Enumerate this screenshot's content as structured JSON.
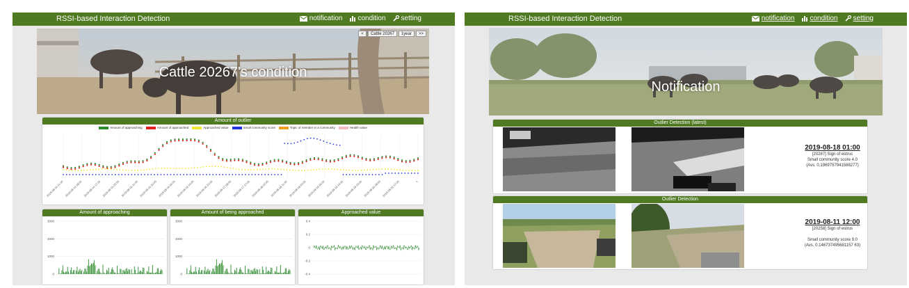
{
  "app": {
    "title": "RSSI-based Interaction Detection",
    "nav": {
      "notification": "notification",
      "condition": "condition",
      "setting": "setting"
    }
  },
  "left": {
    "hero_title": "Cattle 20267's condition",
    "selector": {
      "prev": "<<",
      "prev2": "<",
      "cattle": "Cattle 20267",
      "period": "1year",
      "next": ">>"
    },
    "main_chart": {
      "title": "Amount of outlier",
      "legend": [
        {
          "label": "Amount of approaching",
          "color": "#2e8b2e"
        },
        {
          "label": "Amount of approached",
          "color": "#e02020"
        },
        {
          "label": "Approached value",
          "color": "#f0e830"
        },
        {
          "label": "Small community score",
          "color": "#2233dd"
        },
        {
          "label": "Topic of member in a community",
          "color": "#f0a020"
        },
        {
          "label": "Health value",
          "color": "#f4b8c0"
        }
      ],
      "xlabels": [
        "2019-08-14 01:00",
        "2019-08-14 08:00",
        "2019-08-14 17:00",
        "2019-08-15 02:00",
        "2019-08-15 11:00",
        "2019-08-15 20:00",
        "2019-08-16 05:00",
        "2019-08-16 14:00",
        "2019-08-16 23:00",
        "2019-08-17 08:00",
        "2019-08-17 17:00",
        "2019-08-18 02:00",
        "2019-08-18 11:00",
        "2019-08-18 20:00",
        "2019-08-19 05:00",
        "2019-08-19 14:00",
        "2019-08-19 23:00",
        "2019-08-20 08:00",
        "2019-08-20 17:00",
        "1"
      ]
    },
    "small_charts": [
      {
        "title": "Amount of approaching",
        "yticks": [
          "3000",
          "2000",
          "1000",
          "0"
        ]
      },
      {
        "title": "Amount of being approached",
        "yticks": [
          "3000",
          "2000",
          "1000",
          "0"
        ]
      },
      {
        "title": "Approached value",
        "yticks": [
          "0.4",
          "0.2",
          "0",
          "-0.2",
          "-0.4"
        ]
      }
    ]
  },
  "right": {
    "hero_title": "Notification",
    "cards": [
      {
        "title": "Outlier Detection (latest)",
        "date": "2019-08-18 01:00",
        "line1": "[20267] Sign of estrus",
        "line2": "Small community score 4.0",
        "line3": "(Avs. 0.1969757941588277)"
      },
      {
        "title": "Outlier Detection",
        "date": "2019-08-11 12:00",
        "line1": "[20258] Sign of estrus",
        "line2": "Small community score 9.0",
        "line3": "(Avs. 0.146737495681157 63)"
      }
    ]
  },
  "colors": {
    "header": "#4f7a22",
    "background": "#e9e9e9"
  }
}
